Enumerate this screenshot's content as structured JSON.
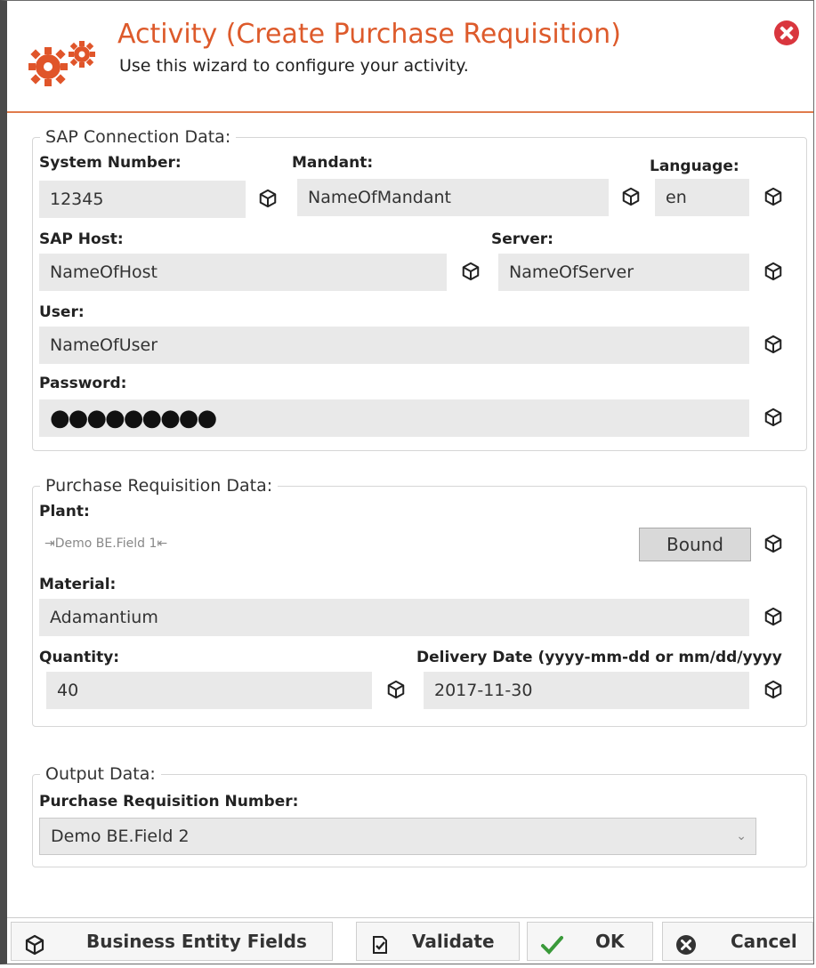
{
  "header": {
    "title": "Activity (Create Purchase Requisition)",
    "subtitle": "Use this wizard to configure your activity."
  },
  "sap": {
    "legend": "SAP Connection Data:",
    "system_number": {
      "label": "System Number:",
      "value": "12345"
    },
    "mandant": {
      "label": "Mandant:",
      "value": "NameOfMandant"
    },
    "language": {
      "label": "Language:",
      "value": "en"
    },
    "host": {
      "label": "SAP Host:",
      "value": "NameOfHost"
    },
    "server": {
      "label": "Server:",
      "value": "NameOfServer"
    },
    "user": {
      "label": "User:",
      "value": "NameOfUser"
    },
    "password": {
      "label": "Password:",
      "value": "●●●●●●●●●"
    }
  },
  "pr": {
    "legend": "Purchase Requisition Data:",
    "plant": {
      "label": "Plant:",
      "bound_value": "⇥Demo BE.Field 1⇤",
      "bound_button": "Bound"
    },
    "material": {
      "label": "Material:",
      "value": "Adamantium"
    },
    "quantity": {
      "label": "Quantity:",
      "value": "40"
    },
    "delivery": {
      "label": "Delivery Date (yyyy-mm-dd or mm/dd/yyyy",
      "value": "2017-11-30"
    }
  },
  "output": {
    "legend": "Output Data:",
    "pr_number": {
      "label": "Purchase Requisition Number:",
      "value": "Demo BE.Field 2"
    }
  },
  "footer": {
    "business_entity": "Business Entity Fields",
    "validate": "Validate",
    "ok": "OK",
    "cancel": "Cancel"
  },
  "colors": {
    "accent": "#dd5a2b",
    "close": "#d9363e",
    "ok_check": "#3a9a3a"
  }
}
